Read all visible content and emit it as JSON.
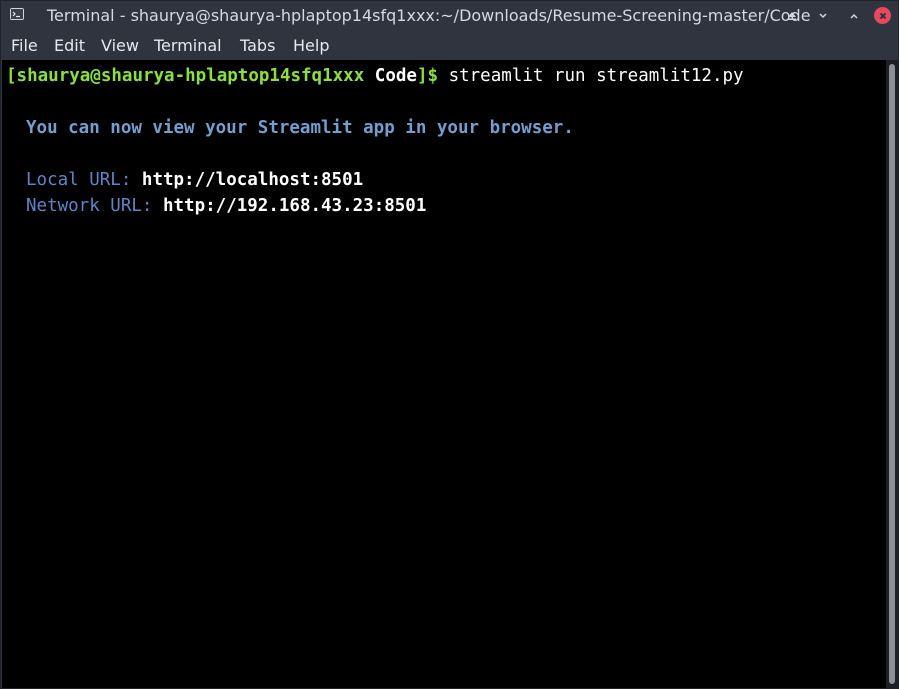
{
  "window": {
    "title": "Terminal - shaurya@shaurya-hplaptop14sfq1xxx:~/Downloads/Resume-Screening-master/Code",
    "app_icon": "terminal-icon",
    "controls": {
      "keep_above": "▲",
      "minimize": "◦",
      "maximize": "◦",
      "close": "×"
    }
  },
  "menubar": {
    "items": [
      "File",
      "Edit",
      "View",
      "Terminal",
      "Tabs",
      "Help"
    ]
  },
  "terminal": {
    "prompt_open": "[",
    "prompt_user_host": "shaurya@shaurya-hplaptop14sfq1xxx",
    "prompt_dir": "Code",
    "prompt_close": "]$",
    "command": "streamlit run streamlit12.py",
    "message": "You can now view your Streamlit app in your browser.",
    "local_label": "Local URL:",
    "local_url": "http://localhost:8501",
    "network_label": "Network URL:",
    "network_url": "http://192.168.43.23:8501"
  },
  "colors": {
    "background": "#000000",
    "prompt_green": "#8ae234",
    "info_blue": "#729fcf",
    "close_red": "#e8475d",
    "titlebar": "#2f343f"
  }
}
